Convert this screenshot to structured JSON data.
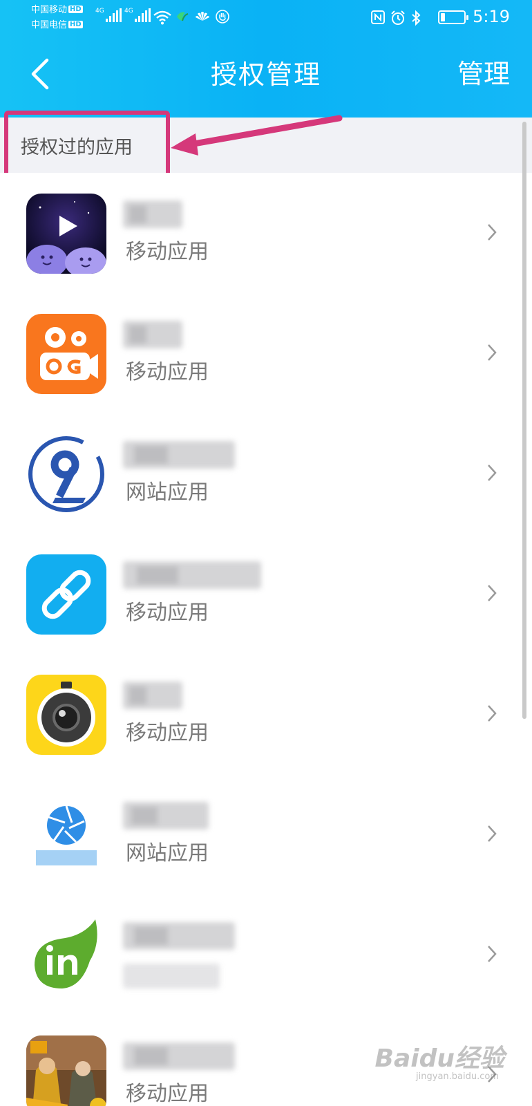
{
  "status_bar": {
    "carrier1": "中国移动",
    "carrier2": "中国电信",
    "hd": "HD",
    "net1": "4G",
    "net2": "4G",
    "time": "5:19",
    "battery_level": 0.2
  },
  "nav": {
    "title": "授权管理",
    "manage": "管理"
  },
  "section": {
    "title": "授权过的应用"
  },
  "apps": [
    {
      "type": "移动应用",
      "icon": "purple-video-app-icon"
    },
    {
      "type": "移动应用",
      "icon": "kuaishou-icon"
    },
    {
      "type": "网站应用",
      "icon": "blue-nine-logo-icon"
    },
    {
      "type": "移动应用",
      "icon": "link-icon"
    },
    {
      "type": "移动应用",
      "icon": "camera-lens-icon"
    },
    {
      "type": "网站应用",
      "icon": "shutter-logo-icon"
    },
    {
      "type": "",
      "icon": "green-in-drop-icon"
    },
    {
      "type": "移动应用",
      "icon": "game-characters-icon"
    }
  ],
  "watermark": {
    "brand": "Baidu经验",
    "url": "jingyan.baidu.com"
  },
  "colors": {
    "header": "#12b7f5",
    "highlight": "#d5387a"
  }
}
